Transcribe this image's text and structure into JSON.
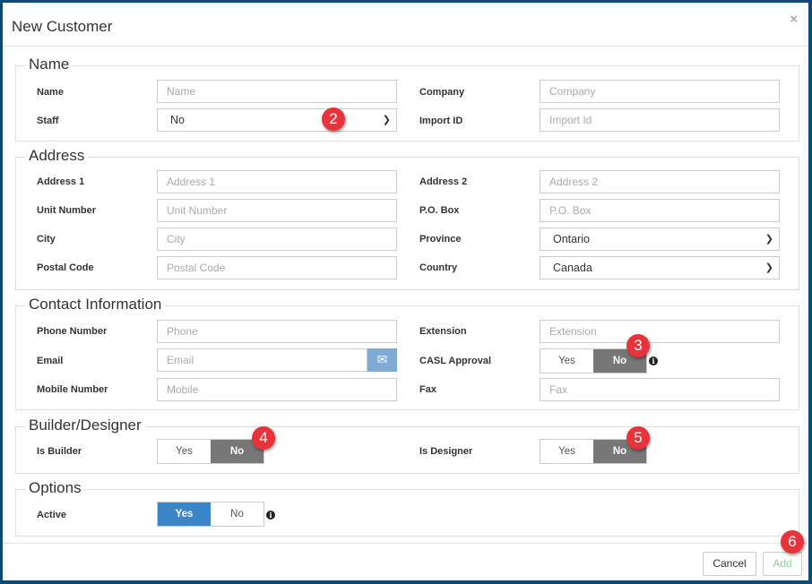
{
  "title": "New Customer",
  "close": "×",
  "sections": {
    "name": {
      "legend": "Name",
      "name_label": "Name",
      "name_ph": "Name",
      "company_label": "Company",
      "company_ph": "Company",
      "staff_label": "Staff",
      "staff_value": "No",
      "import_label": "Import ID",
      "import_ph": "Import Id"
    },
    "address": {
      "legend": "Address",
      "a1_label": "Address 1",
      "a1_ph": "Address 1",
      "a2_label": "Address 2",
      "a2_ph": "Address 2",
      "unit_label": "Unit Number",
      "unit_ph": "Unit Number",
      "po_label": "P.O. Box",
      "po_ph": "P.O. Box",
      "city_label": "City",
      "city_ph": "City",
      "prov_label": "Province",
      "prov_value": "Ontario",
      "postal_label": "Postal Code",
      "postal_ph": "Postal Code",
      "country_label": "Country",
      "country_value": "Canada"
    },
    "contact": {
      "legend": "Contact Information",
      "phone_label": "Phone Number",
      "phone_ph": "Phone",
      "ext_label": "Extension",
      "ext_ph": "Extension",
      "email_label": "Email",
      "email_ph": "Email",
      "casl_label": "CASL Approval",
      "mobile_label": "Mobile Number",
      "mobile_ph": "Mobile",
      "fax_label": "Fax",
      "fax_ph": "Fax"
    },
    "builder": {
      "legend": "Builder/Designer",
      "builder_label": "Is Builder",
      "designer_label": "Is Designer"
    },
    "options": {
      "legend": "Options",
      "active_label": "Active"
    }
  },
  "toggle": {
    "yes": "Yes",
    "no": "No"
  },
  "badges": [
    "2",
    "3",
    "4",
    "5",
    "6"
  ],
  "footer": {
    "cancel": "Cancel",
    "add": "Add"
  }
}
